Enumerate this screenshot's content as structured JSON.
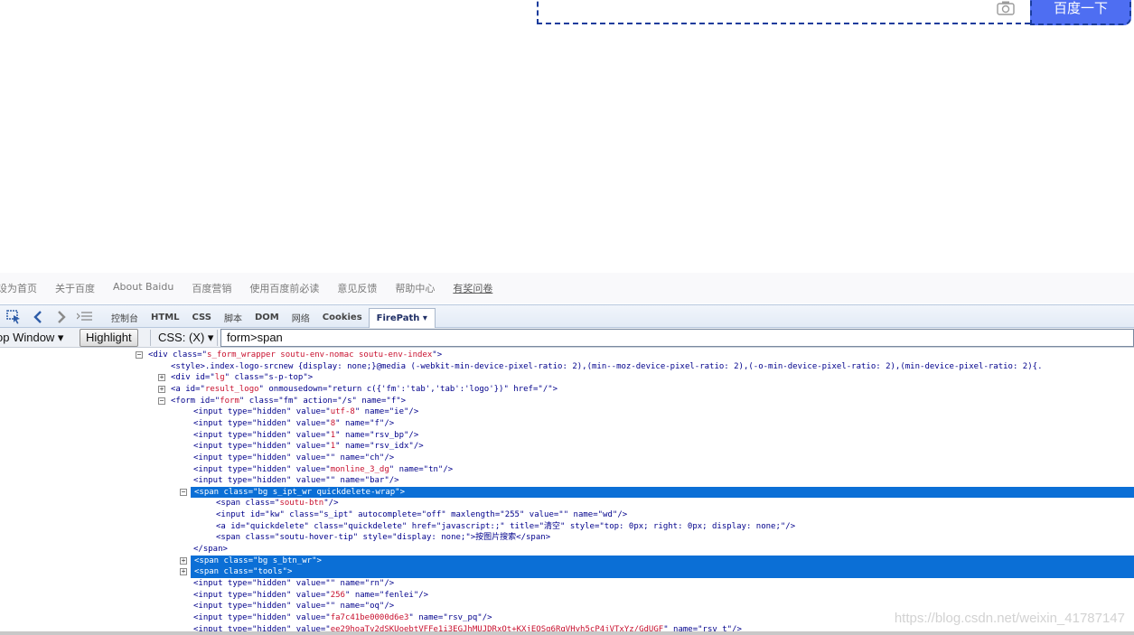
{
  "search": {
    "button_label": "百度一下",
    "camera_icon": "camera-icon"
  },
  "footer": {
    "links": [
      "设为首页",
      "关于百度",
      "About Baidu",
      "百度营销",
      "使用百度前必读",
      "意见反馈",
      "帮助中心",
      "有奖问卷"
    ]
  },
  "firebug": {
    "icons": [
      "inspect-icon",
      "back-icon",
      "forward-icon",
      "console-list-icon"
    ],
    "tabs": [
      "控制台",
      "HTML",
      "CSS",
      "脚本",
      "DOM",
      "网络",
      "Cookies",
      "FirePath ▾"
    ],
    "active_tab": "FirePath ▾"
  },
  "firepath": {
    "window_label": "op Window ▾",
    "highlight_label": "Highlight",
    "css_label": "CSS: (X) ▾",
    "query": "form>span"
  },
  "code_lines": [
    {
      "t": "<div class=\"",
      "a": "s_form_wrapper soutu-env-nomac soutu-env-index",
      "e": "\">"
    },
    {
      "t": "<style>.index-logo-srcnew {display: none;}@media (-webkit-min-device-pixel-ratio: 2),(min--moz-device-pixel-ratio: 2),(-o-min-device-pixel-ratio: 2),(min-device-pixel-ratio: 2){.",
      "a": "",
      "e": ""
    },
    {
      "t": "<div id=\"",
      "a": "lg",
      "e": "\" class=\"s-p-top\">"
    },
    {
      "t": "<a id=\"",
      "a": "result_logo",
      "e": "\" onmousedown=\"return c({'fm':'tab','tab':'logo'})\" href=\"/\">"
    },
    {
      "t": "<form id=\"",
      "a": "form",
      "e": "\" class=\"fm\" action=\"/s\" name=\"f\">"
    },
    {
      "t": "<input type=\"hidden\" value=\"",
      "a": "utf-8",
      "e": "\" name=\"ie\"/>"
    },
    {
      "t": "<input type=\"hidden\" value=\"",
      "a": "8",
      "e": "\" name=\"f\"/>"
    },
    {
      "t": "<input type=\"hidden\" value=\"",
      "a": "1",
      "e": "\" name=\"rsv_bp\"/>"
    },
    {
      "t": "<input type=\"hidden\" value=\"",
      "a": "1",
      "e": "\" name=\"rsv_idx\"/>"
    },
    {
      "t": "<input type=\"hidden\" value=\"",
      "a": "",
      "e": "\" name=\"ch\"/>"
    },
    {
      "t": "<input type=\"hidden\" value=\"",
      "a": "monline_3_dg",
      "e": "\" name=\"tn\"/>"
    },
    {
      "t": "<input type=\"hidden\" value=\"",
      "a": "",
      "e": "\" name=\"bar\"/>"
    },
    {
      "t": "<span class=\"",
      "a": "bg s_ipt_wr quickdelete-wrap",
      "e": "\">"
    },
    {
      "t": "<span class=\"",
      "a": "soutu-btn",
      "e": "\"/>"
    },
    {
      "t": "<input id=\"kw\" class=\"s_ipt\" autocomplete=\"off\" maxlength=\"255\" value=\"\" name=\"wd\"/>",
      "a": "",
      "e": ""
    },
    {
      "t": "<a id=\"quickdelete\" class=\"quickdelete\" href=\"javascript:;\" title=\"清空\" style=\"top: 0px; right: 0px; display: none;\"/>",
      "a": "",
      "e": ""
    },
    {
      "t": "<span class=\"soutu-hover-tip\" style=\"display: none;\">按图片搜索</span>",
      "a": "",
      "e": ""
    },
    {
      "t": "</span>",
      "a": "",
      "e": ""
    },
    {
      "t": "<span class=\"",
      "a": "bg s_btn_wr",
      "e": "\">"
    },
    {
      "t": "<span class=\"",
      "a": "tools",
      "e": "\">"
    },
    {
      "t": "<input type=\"hidden\" value=\"",
      "a": "",
      "e": "\" name=\"rn\"/>"
    },
    {
      "t": "<input type=\"hidden\" value=\"",
      "a": "256",
      "e": "\" name=\"fenlei\"/>"
    },
    {
      "t": "<input type=\"hidden\" value=\"",
      "a": "",
      "e": "\" name=\"oq\"/>"
    },
    {
      "t": "<input type=\"hidden\" value=\"",
      "a": "fa7c41be0000d6e3",
      "e": "\" name=\"rsv_pq\"/>"
    },
    {
      "t": "<input type=\"hidden\" value=\"",
      "a": "ee29hoaTv2dSKUoebtVFFe1i3EGJhMUJDRxQt+KXjEQSg6RqVHyh5cP4jVTxYz/GdUGF",
      "e": "\" name=\"rsv_t\"/>"
    }
  ],
  "watermark": "https://blog.csdn.net/weixin_41787147"
}
